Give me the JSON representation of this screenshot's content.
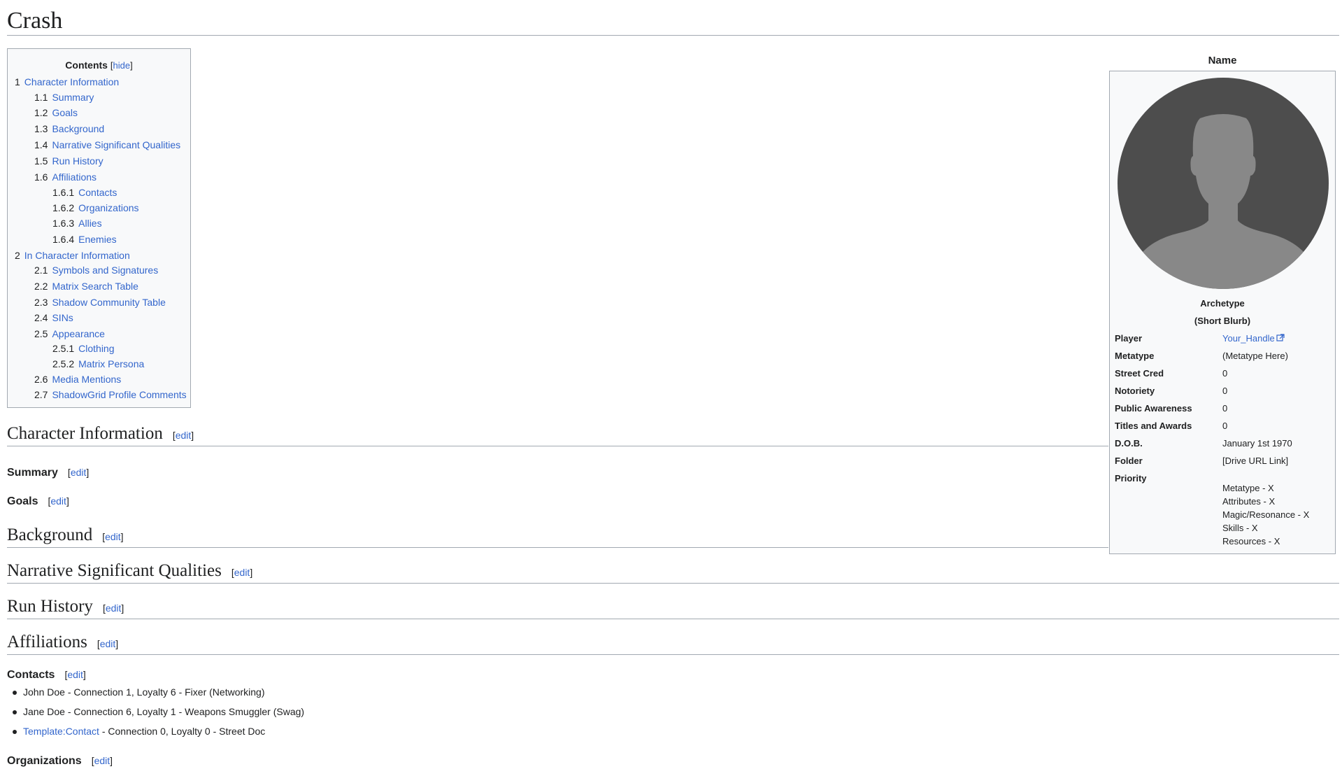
{
  "page": {
    "title": "Crash"
  },
  "toc": {
    "title": "Contents",
    "hide_label": "hide",
    "items": [
      {
        "num": "1",
        "label": "Character Information"
      },
      {
        "num": "1.1",
        "label": "Summary"
      },
      {
        "num": "1.2",
        "label": "Goals"
      },
      {
        "num": "1.3",
        "label": "Background"
      },
      {
        "num": "1.4",
        "label": "Narrative Significant Qualities"
      },
      {
        "num": "1.5",
        "label": "Run History"
      },
      {
        "num": "1.6",
        "label": "Affiliations"
      },
      {
        "num": "1.6.1",
        "label": "Contacts"
      },
      {
        "num": "1.6.2",
        "label": "Organizations"
      },
      {
        "num": "1.6.3",
        "label": "Allies"
      },
      {
        "num": "1.6.4",
        "label": "Enemies"
      },
      {
        "num": "2",
        "label": "In Character Information"
      },
      {
        "num": "2.1",
        "label": "Symbols and Signatures"
      },
      {
        "num": "2.2",
        "label": "Matrix Search Table"
      },
      {
        "num": "2.3",
        "label": "Shadow Community Table"
      },
      {
        "num": "2.4",
        "label": "SINs"
      },
      {
        "num": "2.5",
        "label": "Appearance"
      },
      {
        "num": "2.5.1",
        "label": "Clothing"
      },
      {
        "num": "2.5.2",
        "label": "Matrix Persona"
      },
      {
        "num": "2.6",
        "label": "Media Mentions"
      },
      {
        "num": "2.7",
        "label": "ShadowGrid Profile Comments"
      }
    ]
  },
  "sections": {
    "edit_label": "edit",
    "character_information": "Character Information",
    "summary": "Summary",
    "goals": "Goals",
    "background": "Background",
    "narrative": "Narrative Significant Qualities",
    "run_history": "Run History",
    "affiliations": "Affiliations",
    "contacts": "Contacts",
    "organizations": "Organizations"
  },
  "contacts": [
    {
      "text": "John Doe - Connection 1, Loyalty 6 - Fixer (Networking)"
    },
    {
      "text": "Jane Doe - Connection 6, Loyalty 1 - Weapons Smuggler (Swag)"
    },
    {
      "link": "Template:Contact",
      "text": " - Connection 0, Loyalty 0 - Street Doc"
    }
  ],
  "infobox": {
    "caption": "Name",
    "archetype": "Archetype",
    "blurb": "(Short Blurb)",
    "rows": {
      "player": {
        "label": "Player",
        "value": "Your_Handle"
      },
      "metatype": {
        "label": "Metatype",
        "value": "(Metatype Here)"
      },
      "street_cred": {
        "label": "Street Cred",
        "value": "0"
      },
      "notoriety": {
        "label": "Notoriety",
        "value": "0"
      },
      "public_awareness": {
        "label": "Public Awareness",
        "value": "0"
      },
      "titles": {
        "label": "Titles and Awards",
        "value": "0"
      },
      "dob": {
        "label": "D.O.B.",
        "value": "January 1st 1970"
      },
      "folder": {
        "label": "Folder",
        "value": "[Drive URL Link]"
      },
      "priority": {
        "label": "Priority"
      }
    },
    "priority_items": [
      "Metatype - X",
      "Attributes - X",
      "Magic/Resonance - X",
      "Skills - X",
      "Resources - X"
    ],
    "avatar_colors": {
      "background": "#4d4d4d",
      "silhouette": "#888888"
    }
  }
}
